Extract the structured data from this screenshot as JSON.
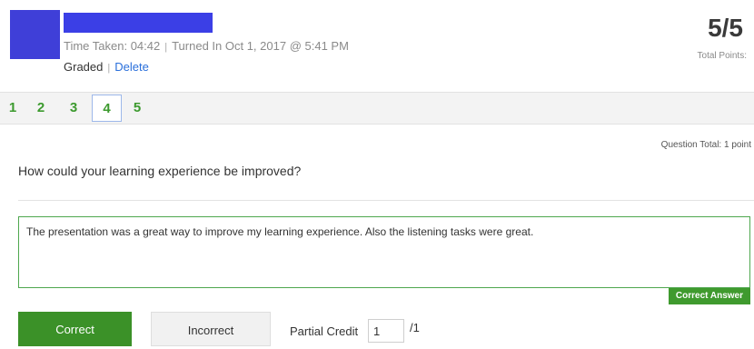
{
  "header": {
    "time_taken": "Time Taken: 04:42",
    "separator": "|",
    "turned_in": "Turned In Oct 1, 2017 @ 5:41 PM",
    "graded": "Graded",
    "delete_label": "Delete",
    "score": "5/5",
    "score_label": "Total Points:"
  },
  "question_nav": {
    "items": [
      "1",
      "2",
      "3",
      "4",
      "5"
    ],
    "active": "4"
  },
  "question": {
    "total": "Question Total: 1 point",
    "prompt": "How could your learning experience be improved?",
    "answer": "The presentation was a great way to improve my learning experience. Also the listening tasks were great.",
    "correct_answer_tag": "Correct Answer"
  },
  "grading": {
    "correct_label": "Correct",
    "incorrect_label": "Incorrect",
    "partial_credit_label": "Partial Credit",
    "partial_credit_value": "1",
    "partial_credit_max": "/1"
  },
  "colors": {
    "accent_green": "#3b9128",
    "link_blue": "#2a6fdb",
    "redaction_blue": "#3b3fe6"
  }
}
